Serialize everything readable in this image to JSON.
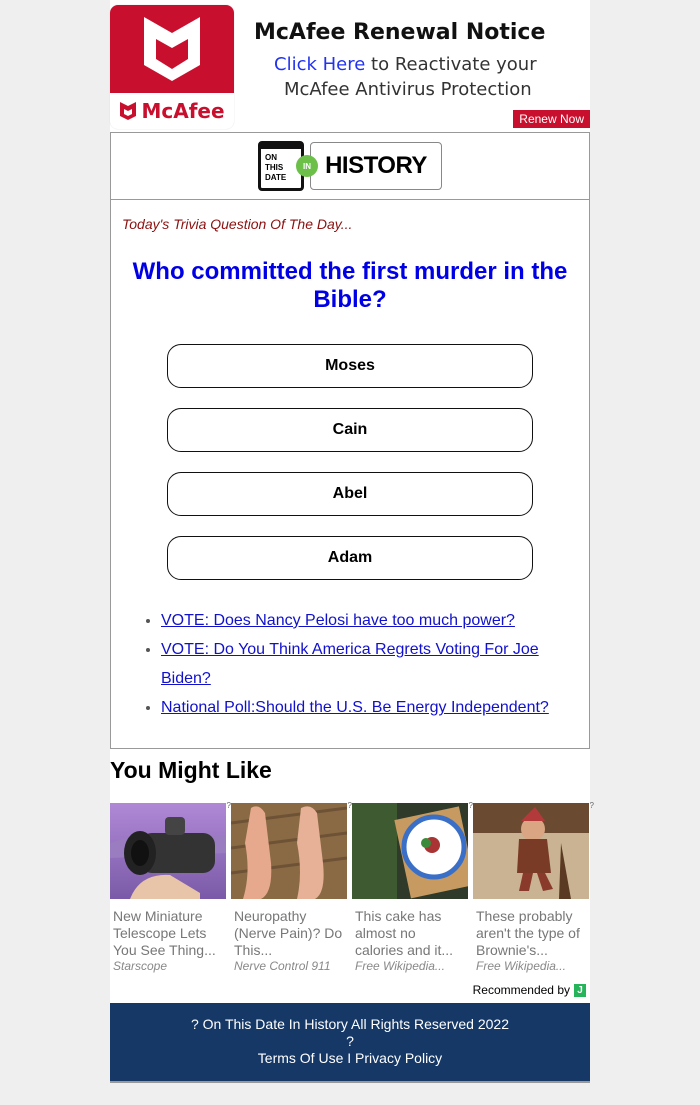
{
  "ad": {
    "brand": "McAfee",
    "title": "McAfee Renewal Notice",
    "link_text": "Click Here",
    "line2_rest": " to Reactivate your",
    "line3": "McAfee Antivirus Protection",
    "button": "Renew Now",
    "colors": {
      "brand_red": "#c8102e",
      "link_blue": "#2233ee"
    }
  },
  "logo": {
    "calendar_lines": [
      "ON",
      "THIS",
      "DATE"
    ],
    "badge": "IN",
    "wordmark": "HISTORY",
    "badge_color": "#6cc04a"
  },
  "trivia": {
    "label": "Today's Trivia Question Of The Day...",
    "question": "Who committed the first murder in the Bible?",
    "answers": [
      "Moses",
      "Cain",
      "Abel",
      "Adam"
    ]
  },
  "links": [
    "VOTE: Does Nancy Pelosi have too much power?",
    "VOTE: Do You Think America Regrets Voting For Joe Biden?",
    "National Poll:Should the U.S. Be Energy Independent?"
  ],
  "recommendations": {
    "heading": "You Might Like",
    "cards": [
      {
        "title": "New Miniature Telescope Lets You See Thing...",
        "source": "Starscope",
        "image": "telescope-image"
      },
      {
        "title": "Neuropathy (Nerve Pain)? Do This...",
        "source": "Nerve Control 911",
        "image": "feet-image"
      },
      {
        "title": "This cake has almost no calories and it...",
        "source": "Free Wikipedia...",
        "image": "cake-plate-image"
      },
      {
        "title": "These probably aren't the type of Brownie's...",
        "source": "Free Wikipedia...",
        "image": "brownie-elf-image"
      }
    ],
    "info_mark": "?",
    "recommended_by": "Recommended by",
    "provider_badge": "J"
  },
  "footer": {
    "copyright": "? On This Date In History All Rights Reserved 2022",
    "separator": "?",
    "terms": "Terms Of Use",
    "divider": " I ",
    "privacy": "Privacy Policy",
    "bg_color": "#163866"
  }
}
